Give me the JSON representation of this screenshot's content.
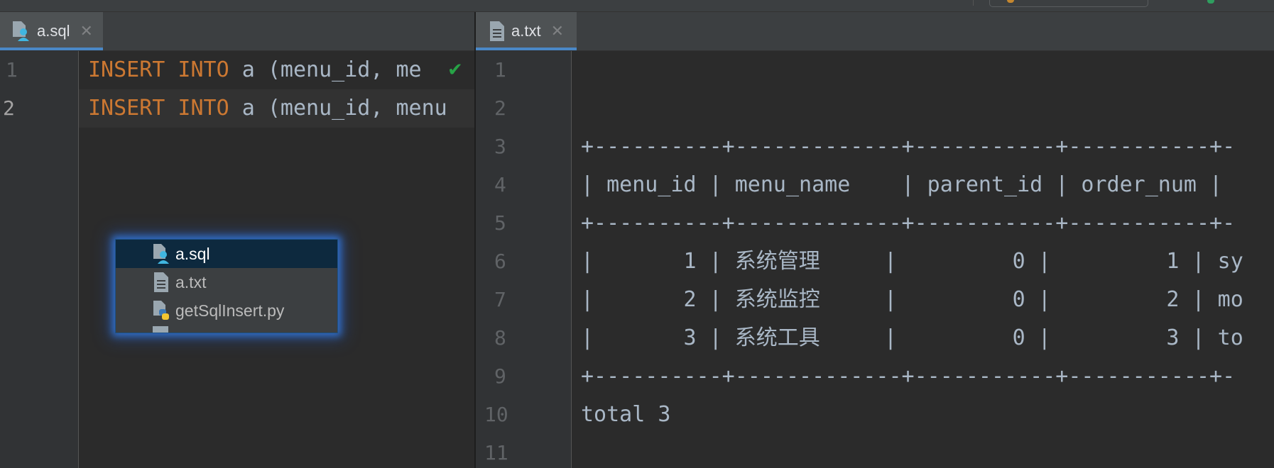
{
  "left_editor": {
    "tab": {
      "filename": "a.sql",
      "close": "✕"
    },
    "lines": [
      {
        "number": "1",
        "keyword": "INSERT INTO",
        "text": " a (menu_id, me",
        "check": "✔"
      },
      {
        "number": "2",
        "keyword": "INSERT INTO",
        "text": " a (menu_id, menu"
      }
    ]
  },
  "file_popup": {
    "items": [
      {
        "label": "a.sql",
        "icon": "sql-file-icon",
        "selected": true
      },
      {
        "label": "a.txt",
        "icon": "text-file-icon",
        "selected": false
      },
      {
        "label": "getSqlInsert.py",
        "icon": "python-file-icon",
        "selected": false
      }
    ]
  },
  "right_editor": {
    "tab": {
      "filename": "a.txt",
      "close": "✕"
    },
    "lines": [
      {
        "number": "1",
        "text": ""
      },
      {
        "number": "2",
        "text": ""
      },
      {
        "number": "3",
        "text": "+----------+-------------+-----------+-----------+-"
      },
      {
        "number": "4",
        "text": "| menu_id | menu_name    | parent_id | order_num | "
      },
      {
        "number": "5",
        "text": "+----------+-------------+-----------+-----------+-"
      },
      {
        "number": "6",
        "text": "|       1 | 系统管理     |         0 |         1 | sy"
      },
      {
        "number": "7",
        "text": "|       2 | 系统监控     |         0 |         2 | mo"
      },
      {
        "number": "8",
        "text": "|       3 | 系统工具     |         0 |         3 | to"
      },
      {
        "number": "9",
        "text": "+----------+-------------+-----------+-----------+-"
      },
      {
        "number": "10",
        "text": "total 3"
      },
      {
        "number": "11",
        "text": ""
      }
    ]
  },
  "colors": {
    "keyword": "#cc7832",
    "text": "#a9b7c6",
    "accent": "#4a88c7",
    "check": "#27a346"
  }
}
